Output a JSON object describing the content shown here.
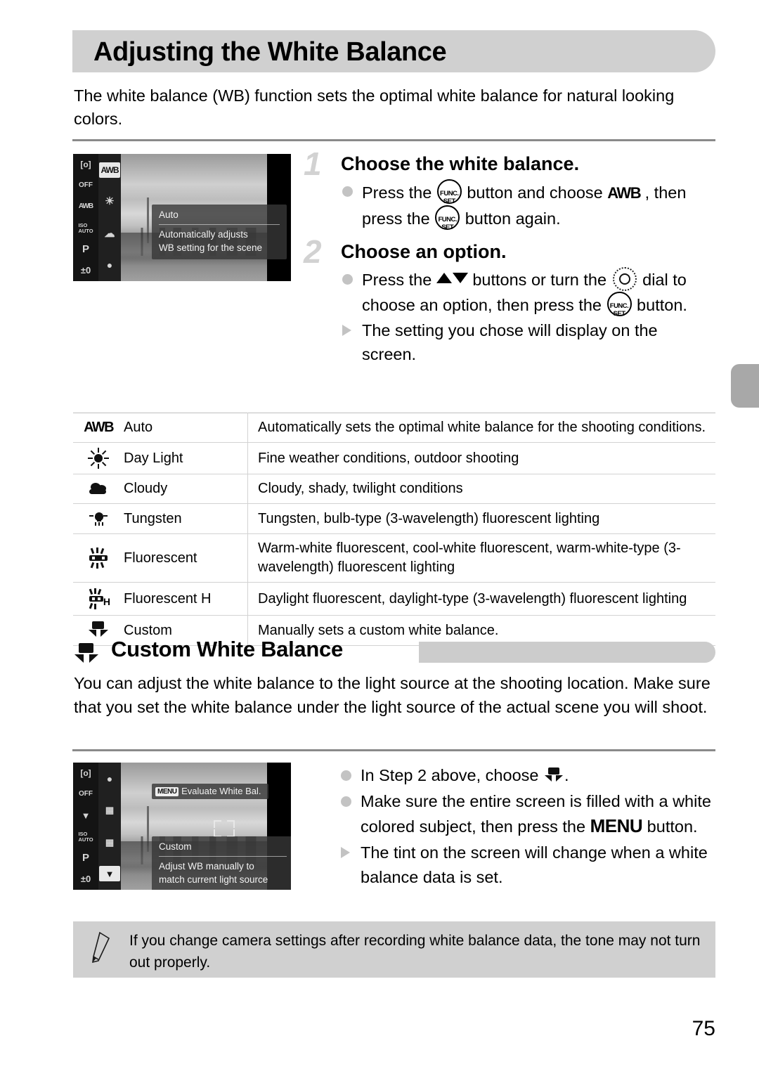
{
  "page": {
    "number": "75"
  },
  "header": {
    "title": "Adjusting the White Balance"
  },
  "intro": "The white balance (WB) function sets the optimal white balance for natural looking colors.",
  "screen1": {
    "strip_a": [
      "[o]",
      "OFF",
      "AWB",
      "ISO AUTO",
      "P",
      "±0"
    ],
    "strip_b": [
      "AWB",
      "sun",
      "cloud",
      "bulb"
    ],
    "panel_title": "Auto",
    "panel_line1": "Automatically adjusts",
    "panel_line2": "WB setting for the scene"
  },
  "screen2": {
    "strip_a": [
      "[o]",
      "OFF",
      "custom",
      "ISO AUTO",
      "P",
      "±0"
    ],
    "strip_b": [
      "bulb",
      "fluor",
      "fluorH",
      "custom"
    ],
    "menu_pill_label": "Evaluate White Bal.",
    "menu_pill_glyph": "MENU",
    "panel_title": "Custom",
    "panel_line1": "Adjust WB manually to",
    "panel_line2": "match current light source"
  },
  "steps": [
    {
      "number": "1",
      "heading": "Choose the white balance.",
      "lines": [
        {
          "marker": "dot",
          "parts": [
            {
              "t": "text",
              "v": "Press the "
            },
            {
              "t": "icon",
              "v": "func-set"
            },
            {
              "t": "text",
              "v": " button and choose "
            },
            {
              "t": "icon",
              "v": "awb"
            },
            {
              "t": "text",
              "v": " , then press the "
            },
            {
              "t": "icon",
              "v": "func-set"
            },
            {
              "t": "text",
              "v": " button again."
            }
          ]
        }
      ]
    },
    {
      "number": "2",
      "heading": "Choose an option.",
      "lines": [
        {
          "marker": "dot",
          "parts": [
            {
              "t": "text",
              "v": "Press the "
            },
            {
              "t": "icon",
              "v": "up-down"
            },
            {
              "t": "text",
              "v": " buttons or turn the "
            },
            {
              "t": "icon",
              "v": "dial"
            },
            {
              "t": "text",
              "v": " dial to choose an option, then press the "
            },
            {
              "t": "icon",
              "v": "func-set"
            },
            {
              "t": "text",
              "v": " button."
            }
          ]
        },
        {
          "marker": "triangle",
          "parts": [
            {
              "t": "text",
              "v": "The setting you chose will display on the screen."
            }
          ]
        }
      ]
    }
  ],
  "table": {
    "rows": [
      {
        "icon": "awb",
        "name": "Auto",
        "desc": "Automatically sets the optimal white balance for the shooting conditions."
      },
      {
        "icon": "daylight",
        "name": "Day Light",
        "desc": "Fine weather conditions, outdoor shooting"
      },
      {
        "icon": "cloudy",
        "name": "Cloudy",
        "desc": "Cloudy, shady, twilight conditions"
      },
      {
        "icon": "tungsten",
        "name": "Tungsten",
        "desc": "Tungsten, bulb-type (3-wavelength) fluorescent lighting"
      },
      {
        "icon": "fluorescent",
        "name": "Fluorescent",
        "desc": "Warm-white fluorescent, cool-white fluorescent, warm-white-type (3-wavelength) fluorescent lighting"
      },
      {
        "icon": "fluorescent-h",
        "name": "Fluorescent H",
        "desc": "Daylight fluorescent, daylight-type (3-wavelength) fluorescent lighting"
      },
      {
        "icon": "custom",
        "name": "Custom",
        "desc": "Manually sets a custom white balance."
      }
    ]
  },
  "section2": {
    "title": "Custom White Balance",
    "paragraph": "You can adjust the white balance to the light source at the shooting location. Make sure that you set the white balance under the light source of the actual scene you will shoot.",
    "lines": [
      {
        "marker": "dot",
        "parts": [
          {
            "t": "text",
            "v": "In Step 2 above, choose "
          },
          {
            "t": "icon",
            "v": "custom"
          },
          {
            "t": "text",
            "v": "."
          }
        ]
      },
      {
        "marker": "dot",
        "parts": [
          {
            "t": "text",
            "v": "Make sure the entire screen is filled with a white colored subject, then press the "
          },
          {
            "t": "icon",
            "v": "menu"
          },
          {
            "t": "text",
            "v": " button."
          }
        ]
      },
      {
        "marker": "triangle",
        "parts": [
          {
            "t": "text",
            "v": "The tint on the screen will change when a white balance data is set."
          }
        ]
      }
    ]
  },
  "note": {
    "text": "If you change camera settings after recording white balance data, the tone may not turn out properly."
  }
}
